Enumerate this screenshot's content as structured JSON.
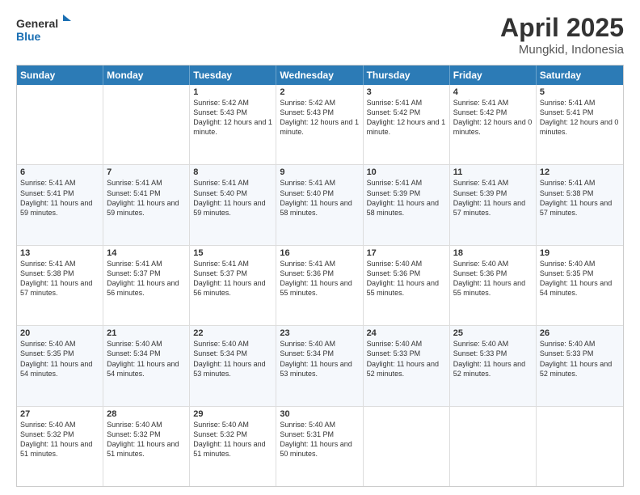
{
  "logo": {
    "general": "General",
    "blue": "Blue"
  },
  "title": {
    "month": "April 2025",
    "location": "Mungkid, Indonesia"
  },
  "header_days": [
    "Sunday",
    "Monday",
    "Tuesday",
    "Wednesday",
    "Thursday",
    "Friday",
    "Saturday"
  ],
  "rows": [
    [
      {
        "day": "",
        "text": ""
      },
      {
        "day": "",
        "text": ""
      },
      {
        "day": "1",
        "text": "Sunrise: 5:42 AM\nSunset: 5:43 PM\nDaylight: 12 hours and 1 minute."
      },
      {
        "day": "2",
        "text": "Sunrise: 5:42 AM\nSunset: 5:43 PM\nDaylight: 12 hours and 1 minute."
      },
      {
        "day": "3",
        "text": "Sunrise: 5:41 AM\nSunset: 5:42 PM\nDaylight: 12 hours and 1 minute."
      },
      {
        "day": "4",
        "text": "Sunrise: 5:41 AM\nSunset: 5:42 PM\nDaylight: 12 hours and 0 minutes."
      },
      {
        "day": "5",
        "text": "Sunrise: 5:41 AM\nSunset: 5:41 PM\nDaylight: 12 hours and 0 minutes."
      }
    ],
    [
      {
        "day": "6",
        "text": "Sunrise: 5:41 AM\nSunset: 5:41 PM\nDaylight: 11 hours and 59 minutes."
      },
      {
        "day": "7",
        "text": "Sunrise: 5:41 AM\nSunset: 5:41 PM\nDaylight: 11 hours and 59 minutes."
      },
      {
        "day": "8",
        "text": "Sunrise: 5:41 AM\nSunset: 5:40 PM\nDaylight: 11 hours and 59 minutes."
      },
      {
        "day": "9",
        "text": "Sunrise: 5:41 AM\nSunset: 5:40 PM\nDaylight: 11 hours and 58 minutes."
      },
      {
        "day": "10",
        "text": "Sunrise: 5:41 AM\nSunset: 5:39 PM\nDaylight: 11 hours and 58 minutes."
      },
      {
        "day": "11",
        "text": "Sunrise: 5:41 AM\nSunset: 5:39 PM\nDaylight: 11 hours and 57 minutes."
      },
      {
        "day": "12",
        "text": "Sunrise: 5:41 AM\nSunset: 5:38 PM\nDaylight: 11 hours and 57 minutes."
      }
    ],
    [
      {
        "day": "13",
        "text": "Sunrise: 5:41 AM\nSunset: 5:38 PM\nDaylight: 11 hours and 57 minutes."
      },
      {
        "day": "14",
        "text": "Sunrise: 5:41 AM\nSunset: 5:37 PM\nDaylight: 11 hours and 56 minutes."
      },
      {
        "day": "15",
        "text": "Sunrise: 5:41 AM\nSunset: 5:37 PM\nDaylight: 11 hours and 56 minutes."
      },
      {
        "day": "16",
        "text": "Sunrise: 5:41 AM\nSunset: 5:36 PM\nDaylight: 11 hours and 55 minutes."
      },
      {
        "day": "17",
        "text": "Sunrise: 5:40 AM\nSunset: 5:36 PM\nDaylight: 11 hours and 55 minutes."
      },
      {
        "day": "18",
        "text": "Sunrise: 5:40 AM\nSunset: 5:36 PM\nDaylight: 11 hours and 55 minutes."
      },
      {
        "day": "19",
        "text": "Sunrise: 5:40 AM\nSunset: 5:35 PM\nDaylight: 11 hours and 54 minutes."
      }
    ],
    [
      {
        "day": "20",
        "text": "Sunrise: 5:40 AM\nSunset: 5:35 PM\nDaylight: 11 hours and 54 minutes."
      },
      {
        "day": "21",
        "text": "Sunrise: 5:40 AM\nSunset: 5:34 PM\nDaylight: 11 hours and 54 minutes."
      },
      {
        "day": "22",
        "text": "Sunrise: 5:40 AM\nSunset: 5:34 PM\nDaylight: 11 hours and 53 minutes."
      },
      {
        "day": "23",
        "text": "Sunrise: 5:40 AM\nSunset: 5:34 PM\nDaylight: 11 hours and 53 minutes."
      },
      {
        "day": "24",
        "text": "Sunrise: 5:40 AM\nSunset: 5:33 PM\nDaylight: 11 hours and 52 minutes."
      },
      {
        "day": "25",
        "text": "Sunrise: 5:40 AM\nSunset: 5:33 PM\nDaylight: 11 hours and 52 minutes."
      },
      {
        "day": "26",
        "text": "Sunrise: 5:40 AM\nSunset: 5:33 PM\nDaylight: 11 hours and 52 minutes."
      }
    ],
    [
      {
        "day": "27",
        "text": "Sunrise: 5:40 AM\nSunset: 5:32 PM\nDaylight: 11 hours and 51 minutes."
      },
      {
        "day": "28",
        "text": "Sunrise: 5:40 AM\nSunset: 5:32 PM\nDaylight: 11 hours and 51 minutes."
      },
      {
        "day": "29",
        "text": "Sunrise: 5:40 AM\nSunset: 5:32 PM\nDaylight: 11 hours and 51 minutes."
      },
      {
        "day": "30",
        "text": "Sunrise: 5:40 AM\nSunset: 5:31 PM\nDaylight: 11 hours and 50 minutes."
      },
      {
        "day": "",
        "text": ""
      },
      {
        "day": "",
        "text": ""
      },
      {
        "day": "",
        "text": ""
      }
    ]
  ]
}
